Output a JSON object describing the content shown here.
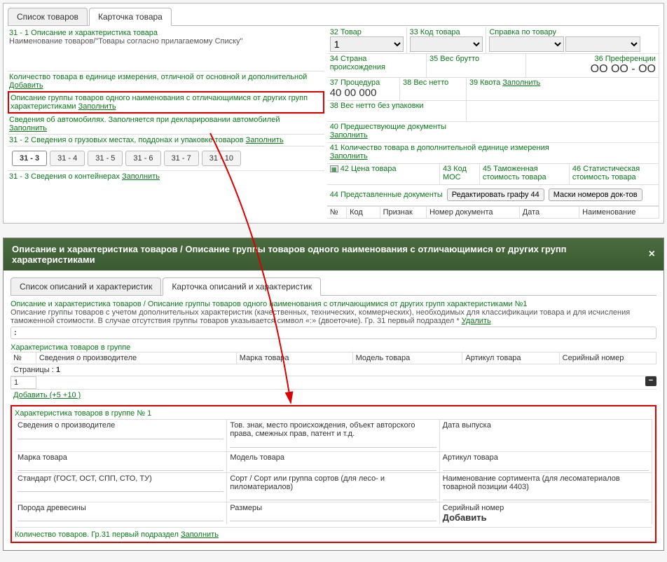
{
  "topTabs": {
    "list": "Список товаров",
    "card": "Карточка товара"
  },
  "left": {
    "title": "31 - 1 Описание и характеристика товара",
    "nameLabel": "Наименование товаров/\"Товары согласно прилагаемому Списку\"",
    "qtyDiffUnit": "Количество товара в единице измерения, отличной от основной и дополнительной",
    "add": "Добавить",
    "groupDesc": "Описание группы товаров одного наименования с отличающимися от других групп характеристиками",
    "fill": "Заполнить",
    "auto": "Сведения об автомобилях. Заполняется при декларировании автомобилей",
    "cargo": "31 - 2 Сведения о грузовых местах, поддонах и упаковке товаров",
    "subtabs": [
      "31 - 3",
      "31 - 4",
      "31 - 5",
      "31 - 6",
      "31 - 7",
      "31 - 10"
    ],
    "containers": "31 - 3 Сведения о контейнерах"
  },
  "right": {
    "c32": "32 Товар",
    "v32": "1",
    "c33": "33 Код товара",
    "ref": "Справка по товару",
    "c34": "34 Страна происхождения",
    "c35": "35 Вес брутто",
    "c36": "36 Преференции",
    "v36": "ОО  ОО  -   ОО",
    "c37": "37 Процедура",
    "v37": "40  00   000",
    "c38": "38 Вес нетто",
    "c39": "39 Квота",
    "fill": "Заполнить",
    "c38b": "38 Вес нетто без упаковки",
    "c40": "40 Предшествующие документы",
    "c41": "41 Количество товара в дополнительной единице измерения",
    "c42": "42 Цена товара",
    "c43": "43 Код МОС",
    "c45": "45 Таможенная стоимость товара",
    "c46": "46 Статистическая стоимость товара",
    "c44": "44 Представленные документы",
    "btnEdit": "Редактировать графу 44",
    "btnMask": "Маски номеров док-тов",
    "thNo": "№",
    "thCode": "Код",
    "thSign": "Признак",
    "thDocNo": "Номер документа",
    "thDate": "Дата",
    "thName": "Наименование"
  },
  "dialog": {
    "title": "Описание и характеристика товаров / Описание группы товаров одного наименования с отличающимися от других групп характеристиками",
    "tabList": "Список описаний и характеристик",
    "tabCard": "Карточка описаний и характеристик",
    "titleLine": "Описание и характеристика товаров / Описание группы товаров одного наименования с отличающимися от других групп характеристиками №1",
    "desc": "Описание группы товаров с учетом дополнительных характеристик (качественных, технических, коммерческих), необходимых для классификации товара и для исчисления таможенной стоимости. В случае отсутствия группы товаров указывается символ «:» (двоеточие). Гр. 31 первый подраздел *",
    "delete": "Удалить",
    "colon": ":",
    "groupChar": "Характеристика товаров в группе",
    "thNo": "№",
    "thProd": "Сведения о производителе",
    "thBrand": "Марка товара",
    "thModel": "Модель товара",
    "thArt": "Артикул товара",
    "thSer": "Серийный номер",
    "pages": "Страницы :",
    "page": "1",
    "rowNo": "1",
    "addRow": "Добавить  (+5  +10 )",
    "cardTitle": "Характеристика товаров в группе № 1",
    "f_prod": "Сведения о производителе",
    "f_tm": "Тов. знак, место происхождения, объект авторского права, смежных прав, патент и т.д.",
    "f_date": "Дата выпуска",
    "f_brand": "Марка товара",
    "f_model": "Модель товара",
    "f_art": "Артикул товара",
    "f_std": "Стандарт (ГОСТ, ОСТ, СПП, СТО, ТУ)",
    "f_sort": "Сорт / Сорт или группа сортов (для лесо- и пиломатериалов)",
    "f_assort": "Наименование сортимента (для лесоматериалов товарной позиции 4403)",
    "f_wood": "Порода древесины",
    "f_size": "Размеры",
    "f_serial": "Серийный номер",
    "addBold": "Добавить",
    "qtyGoods": "Количество товаров. Гр.31 первый подраздел",
    "fill": "Заполнить"
  }
}
